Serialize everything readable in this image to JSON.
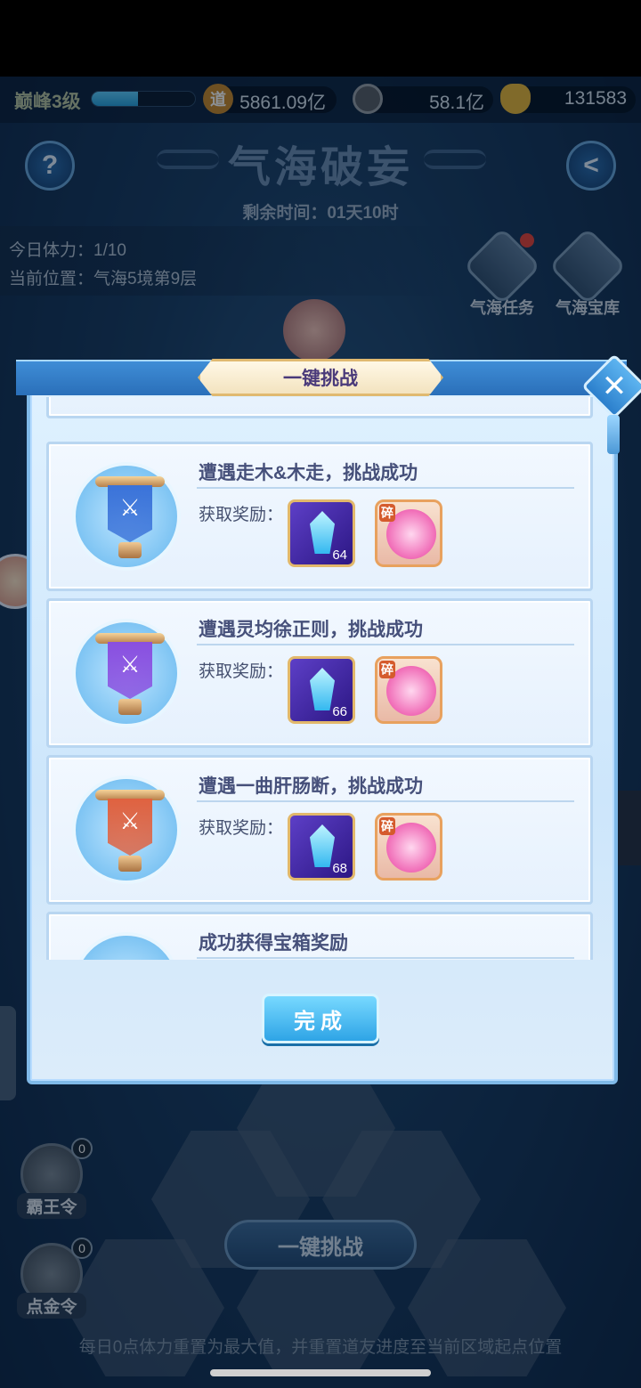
{
  "hud": {
    "level": "巅峰3级",
    "level_progress": 0.45,
    "dao_icon": "道",
    "dao_value": "5861.09亿",
    "coin_value": "58.1亿",
    "gold_value": "131583"
  },
  "header": {
    "help_icon": "?",
    "back_icon": "<",
    "title": "气海破妄",
    "remaining": "剩余时间：01天10时"
  },
  "info": {
    "stamina": "今日体力：1/10",
    "position": "当前位置：气海5境第9层"
  },
  "side_buttons": [
    {
      "label": "气海任务"
    },
    {
      "label": "气海宝库"
    }
  ],
  "modal": {
    "title": "一键挑战",
    "close_icon": "✕",
    "cards": [
      {
        "title": "遭遇走木&木走，挑战成功",
        "reward_label": "获取奖励：",
        "crystal_count": "64",
        "orb_tag": "碎",
        "banner_color": "#3b73d9"
      },
      {
        "title": "遭遇灵均徐正则，挑战成功",
        "reward_label": "获取奖励：",
        "crystal_count": "66",
        "orb_tag": "碎",
        "banner_color": "#8a4fe0"
      },
      {
        "title": "遭遇一曲肝肠断，挑战成功",
        "reward_label": "获取奖励：",
        "crystal_count": "68",
        "orb_tag": "碎",
        "banner_color": "#e06240"
      },
      {
        "title": "成功获得宝箱奖励"
      }
    ],
    "done_label": "完成"
  },
  "bottom": {
    "tokens": [
      {
        "label": "霸王令",
        "count": "0"
      },
      {
        "label": "点金令",
        "count": "0"
      }
    ],
    "challenge_label": "一键挑战",
    "tip": "每日0点体力重置为最大值，并重置道友进度至当前区域起点位置"
  }
}
